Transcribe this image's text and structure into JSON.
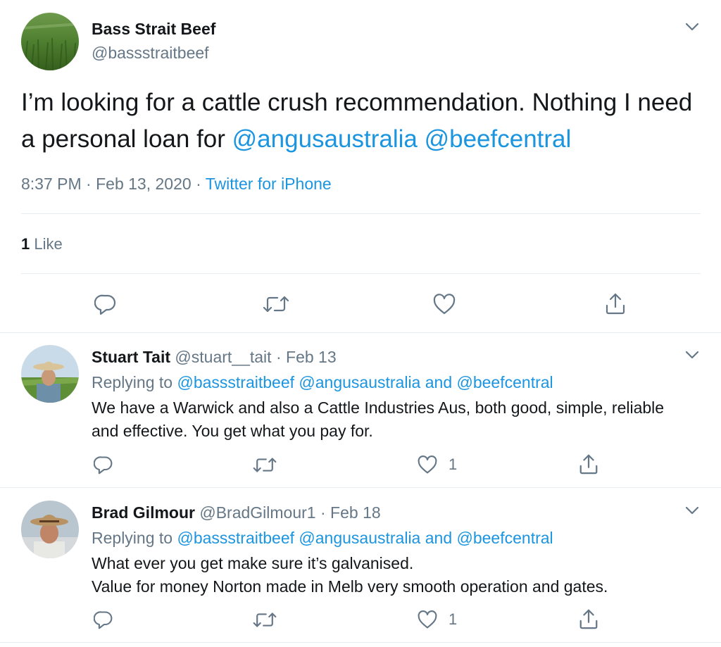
{
  "main_tweet": {
    "display_name": "Bass Strait Beef",
    "handle": "@bassstraitbeef",
    "text_plain": "I’m looking for a cattle crush recommendation. Nothing I need a personal loan for",
    "mention_1": "@angusaustralia",
    "mention_2": "@beefcentral",
    "time": "8:37 PM",
    "date": "Feb 13, 2020",
    "sep": "·",
    "source": "Twitter for iPhone",
    "like_count": "1",
    "like_label": "Like"
  },
  "replies": [
    {
      "display_name": "Stuart Tait",
      "handle": "@stuart__tait",
      "sep": "·",
      "date": "Feb 13",
      "replying_prefix": "Replying to",
      "replying_handles": "@bassstraitbeef @angusaustralia and @beefcentral",
      "text": "We have a Warwick and also a Cattle Industries Aus, both good, simple, reliable and effective. You get what you pay for.",
      "like_count": "1"
    },
    {
      "display_name": "Brad Gilmour",
      "handle": "@BradGilmour1",
      "sep": "·",
      "date": "Feb 18",
      "replying_prefix": "Replying to",
      "replying_handles": "@bassstraitbeef @angusaustralia and @beefcentral",
      "text_line1": "What ever you get make sure it’s galvanised.",
      "text_line2": "Value for money Norton made in Melb very smooth operation and gates.",
      "like_count": "1"
    }
  ],
  "icons": [
    "reply-icon",
    "retweet-icon",
    "like-icon",
    "share-icon",
    "chevron-down-icon"
  ],
  "colors": {
    "link": "#1b95e0",
    "muted": "#657786",
    "text": "#14171a",
    "divider": "#e6ecf0"
  }
}
